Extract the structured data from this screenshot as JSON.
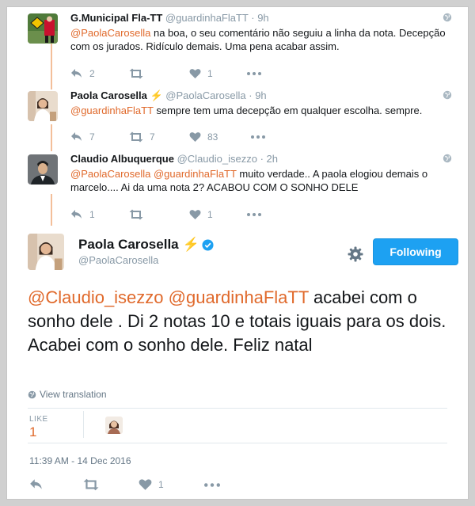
{
  "colors": {
    "mention": "#e0692b",
    "follow_button": "#1da1f2",
    "thread_line": "#f3bf9a",
    "verified": "#1da1f2"
  },
  "replies": [
    {
      "name": "G.Municipal Fla-TT",
      "handle": "@guardinhaFlaTT",
      "time": "· 9h",
      "text_mention": "@PaolaCarosella",
      "text_rest": " na boa, o seu comentário não seguiu a linha da nota. Decepção com os jurados. Ridículo demais. Uma pena acabar assim.",
      "reply_count": "2",
      "retweet_count": "",
      "like_count": "1"
    },
    {
      "name": "Paola Carosella",
      "bolt": "⚡",
      "handle": "@PaolaCarosella",
      "time": "· 9h",
      "text_mention": "@guardinhaFlaTT",
      "text_rest": " sempre tem uma decepção em qualquer escolha. sempre.",
      "reply_count": "7",
      "retweet_count": "7",
      "like_count": "83"
    },
    {
      "name": "Claudio Albuquerque",
      "handle": "@Claudio_isezzo",
      "time": "· 2h",
      "text_mention": "@PaolaCarosella @guardinhaFlaTT",
      "text_rest": " muito verdade.. A paola elogiou demais o marcelo.... Ai da uma nota 2? ACABOU COM O SONHO DELE",
      "reply_count": "1",
      "retweet_count": "",
      "like_count": "1"
    }
  ],
  "main_tweet": {
    "name": "Paola Carosella",
    "bolt": "⚡",
    "handle": "@PaolaCarosella",
    "follow_label": "Following",
    "text_mention": "@Claudio_isezzo @guardinhaFlaTT",
    "text_rest": " acabei com o sonho dele . Di 2 notas 10 e totais iguais para os dois. Acabei com o sonho dele. Feliz natal",
    "translate_label": "View translation",
    "likes_label": "LIKE",
    "likes_count": "1",
    "timestamp": "11:39 AM - 14 Dec 2016",
    "like_action_count": "1"
  }
}
